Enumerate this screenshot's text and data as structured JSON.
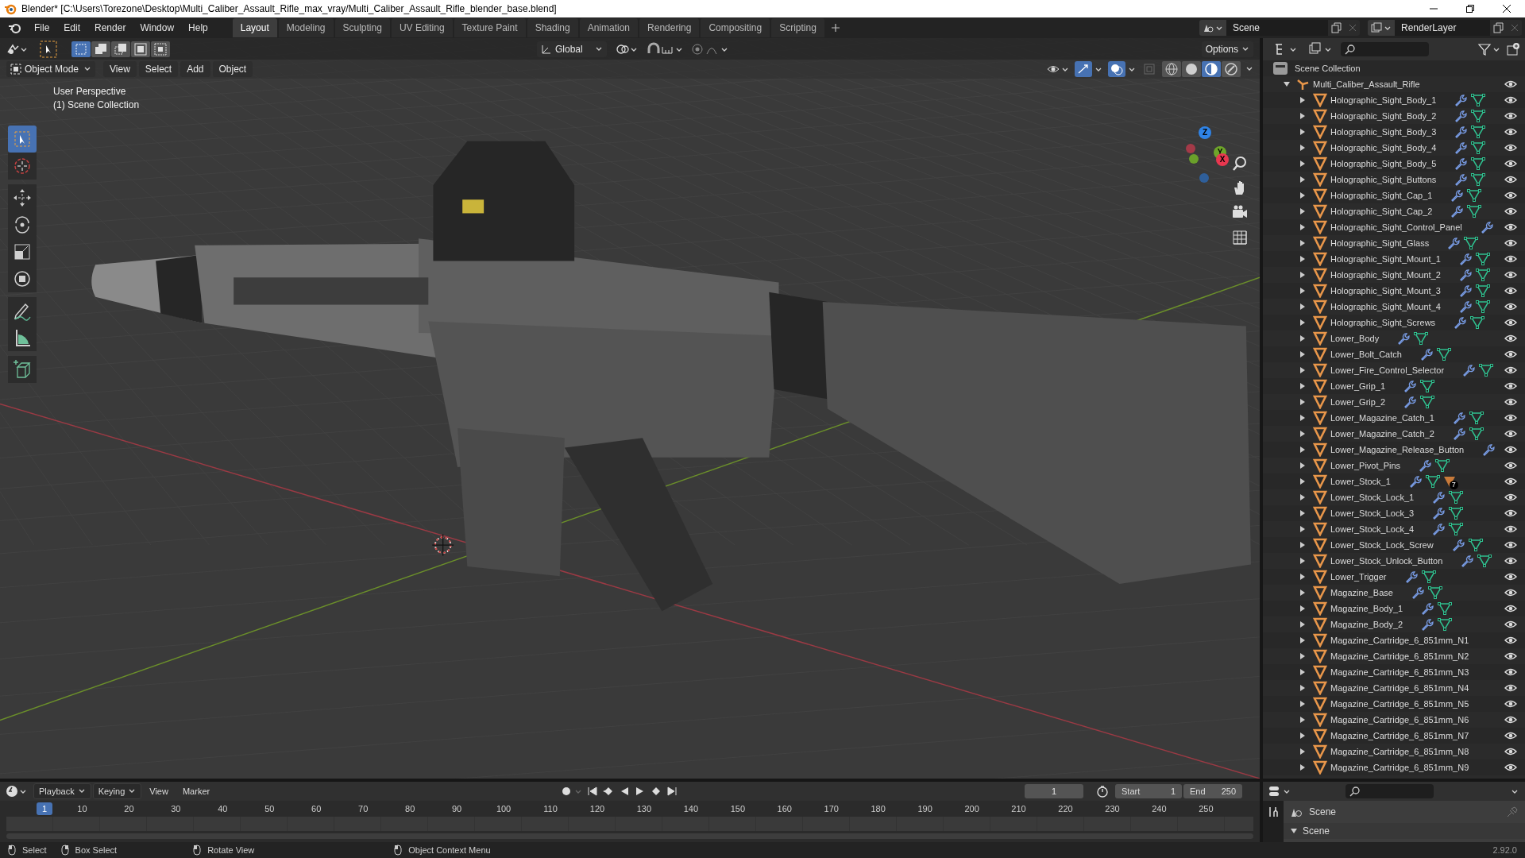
{
  "window": {
    "title": "Blender* [C:\\Users\\Torezone\\Desktop\\Multi_Caliber_Assault_Rifle_max_vray/Multi_Caliber_Assault_Rifle_blender_base.blend]"
  },
  "menu": [
    "File",
    "Edit",
    "Render",
    "Window",
    "Help"
  ],
  "workspaces": [
    {
      "label": "Layout",
      "selected": true
    },
    {
      "label": "Modeling",
      "selected": false
    },
    {
      "label": "Sculpting",
      "selected": false
    },
    {
      "label": "UV Editing",
      "selected": false
    },
    {
      "label": "Texture Paint",
      "selected": false
    },
    {
      "label": "Shading",
      "selected": false
    },
    {
      "label": "Animation",
      "selected": false
    },
    {
      "label": "Rendering",
      "selected": false
    },
    {
      "label": "Compositing",
      "selected": false
    },
    {
      "label": "Scripting",
      "selected": false
    }
  ],
  "scene": {
    "value": "Scene"
  },
  "view_layer": {
    "value": "RenderLayer"
  },
  "tool_header": {
    "select_modes": [
      {
        "selected": true
      },
      {
        "selected": false
      },
      {
        "selected": false
      },
      {
        "selected": false
      },
      {
        "selected": false
      }
    ],
    "orientation": "Global",
    "options": "Options"
  },
  "viewport": {
    "mode": "Object Mode",
    "menus": [
      "View",
      "Select",
      "Add",
      "Object"
    ],
    "view_name": "User Perspective",
    "collection_label": "(1) Scene Collection",
    "tools": [
      {
        "kind": "select_box",
        "selected": true
      },
      {
        "kind": "cursor",
        "selected": false
      },
      {
        "kind": "move",
        "selected": false
      },
      {
        "kind": "rotate",
        "selected": false
      },
      {
        "kind": "scale",
        "selected": false
      },
      {
        "kind": "transform",
        "selected": false
      },
      {
        "kind": "annotate",
        "selected": false
      },
      {
        "kind": "measure",
        "selected": false
      },
      {
        "kind": "add_cube",
        "selected": false
      }
    ],
    "shading": [
      {
        "kind": "wireframe",
        "selected": false
      },
      {
        "kind": "solid",
        "selected": false
      },
      {
        "kind": "material",
        "selected": true
      },
      {
        "kind": "rendered",
        "selected": false
      }
    ],
    "gizmo_axes": [
      {
        "label": "Z",
        "color": "#2f83e6"
      },
      {
        "label": "Y",
        "color": "#6ea52a"
      },
      {
        "label": "X",
        "color": "#e8374f"
      }
    ]
  },
  "outliner": {
    "root": "Scene Collection",
    "collections": [
      {
        "name": "Multi_Caliber_Assault_Rifle",
        "expanded": true,
        "children": [
          {
            "name": "Holographic_Sight_Body_1",
            "expanded": false,
            "modifier": true,
            "mesh": true,
            "visible": true
          },
          {
            "name": "Holographic_Sight_Body_2",
            "expanded": false,
            "modifier": true,
            "mesh": true,
            "visible": true
          },
          {
            "name": "Holographic_Sight_Body_3",
            "expanded": false,
            "modifier": true,
            "mesh": true,
            "visible": true
          },
          {
            "name": "Holographic_Sight_Body_4",
            "expanded": false,
            "modifier": true,
            "mesh": true,
            "visible": true
          },
          {
            "name": "Holographic_Sight_Body_5",
            "expanded": false,
            "modifier": true,
            "mesh": true,
            "visible": true
          },
          {
            "name": "Holographic_Sight_Buttons",
            "expanded": false,
            "modifier": true,
            "mesh": true,
            "visible": true
          },
          {
            "name": "Holographic_Sight_Cap_1",
            "expanded": false,
            "modifier": true,
            "mesh": true,
            "visible": true
          },
          {
            "name": "Holographic_Sight_Cap_2",
            "expanded": false,
            "modifier": true,
            "mesh": true,
            "visible": true
          },
          {
            "name": "Holographic_Sight_Control_Panel",
            "expanded": false,
            "modifier": true,
            "mesh": false,
            "visible": true
          },
          {
            "name": "Holographic_Sight_Glass",
            "expanded": false,
            "modifier": true,
            "mesh": true,
            "visible": true
          },
          {
            "name": "Holographic_Sight_Mount_1",
            "expanded": false,
            "modifier": true,
            "mesh": true,
            "visible": true
          },
          {
            "name": "Holographic_Sight_Mount_2",
            "expanded": false,
            "modifier": true,
            "mesh": true,
            "visible": true
          },
          {
            "name": "Holographic_Sight_Mount_3",
            "expanded": false,
            "modifier": true,
            "mesh": true,
            "visible": true
          },
          {
            "name": "Holographic_Sight_Mount_4",
            "expanded": false,
            "modifier": true,
            "mesh": true,
            "visible": true
          },
          {
            "name": "Holographic_Sight_Screws",
            "expanded": false,
            "modifier": true,
            "mesh": true,
            "visible": true
          },
          {
            "name": "Lower_Body",
            "expanded": false,
            "modifier": true,
            "mesh": true,
            "visible": true
          },
          {
            "name": "Lower_Bolt_Catch",
            "expanded": false,
            "modifier": true,
            "mesh": true,
            "visible": true
          },
          {
            "name": "Lower_Fire_Control_Selector",
            "expanded": false,
            "modifier": true,
            "mesh": true,
            "visible": true
          },
          {
            "name": "Lower_Grip_1",
            "expanded": false,
            "modifier": true,
            "mesh": true,
            "visible": true
          },
          {
            "name": "Lower_Grip_2",
            "expanded": false,
            "modifier": true,
            "mesh": true,
            "visible": true
          },
          {
            "name": "Lower_Magazine_Catch_1",
            "expanded": false,
            "modifier": true,
            "mesh": true,
            "visible": true
          },
          {
            "name": "Lower_Magazine_Catch_2",
            "expanded": false,
            "modifier": true,
            "mesh": true,
            "visible": true
          },
          {
            "name": "Lower_Magazine_Release_Button",
            "expanded": false,
            "modifier": true,
            "mesh": false,
            "visible": true
          },
          {
            "name": "Lower_Pivot_Pins",
            "expanded": false,
            "modifier": true,
            "mesh": true,
            "visible": true
          },
          {
            "name": "Lower_Stock_1",
            "expanded": false,
            "modifier": true,
            "mesh": true,
            "material_count": "7",
            "visible": true
          },
          {
            "name": "Lower_Stock_Lock_1",
            "expanded": false,
            "modifier": true,
            "mesh": true,
            "visible": true
          },
          {
            "name": "Lower_Stock_Lock_3",
            "expanded": false,
            "modifier": true,
            "mesh": true,
            "visible": true
          },
          {
            "name": "Lower_Stock_Lock_4",
            "expanded": false,
            "modifier": true,
            "mesh": true,
            "visible": true
          },
          {
            "name": "Lower_Stock_Lock_Screw",
            "expanded": false,
            "modifier": true,
            "mesh": true,
            "visible": true
          },
          {
            "name": "Lower_Stock_Unlock_Button",
            "expanded": false,
            "modifier": true,
            "mesh": true,
            "visible": true
          },
          {
            "name": "Lower_Trigger",
            "expanded": false,
            "modifier": true,
            "mesh": true,
            "visible": true
          },
          {
            "name": "Magazine_Base",
            "expanded": false,
            "modifier": true,
            "mesh": true,
            "visible": true
          },
          {
            "name": "Magazine_Body_1",
            "expanded": false,
            "modifier": true,
            "mesh": true,
            "visible": true
          },
          {
            "name": "Magazine_Body_2",
            "expanded": false,
            "modifier": true,
            "mesh": true,
            "visible": true
          },
          {
            "name": "Magazine_Cartridge_6_851mm_N1",
            "expanded": false,
            "modifier": false,
            "mesh": false,
            "visible": true
          },
          {
            "name": "Magazine_Cartridge_6_851mm_N2",
            "expanded": false,
            "modifier": false,
            "mesh": false,
            "visible": true
          },
          {
            "name": "Magazine_Cartridge_6_851mm_N3",
            "expanded": false,
            "modifier": false,
            "mesh": false,
            "visible": true
          },
          {
            "name": "Magazine_Cartridge_6_851mm_N4",
            "expanded": false,
            "modifier": false,
            "mesh": false,
            "visible": true
          },
          {
            "name": "Magazine_Cartridge_6_851mm_N5",
            "expanded": false,
            "modifier": false,
            "mesh": false,
            "visible": true
          },
          {
            "name": "Magazine_Cartridge_6_851mm_N6",
            "expanded": false,
            "modifier": false,
            "mesh": false,
            "visible": true
          },
          {
            "name": "Magazine_Cartridge_6_851mm_N7",
            "expanded": false,
            "modifier": false,
            "mesh": false,
            "visible": true
          },
          {
            "name": "Magazine_Cartridge_6_851mm_N8",
            "expanded": false,
            "modifier": false,
            "mesh": false,
            "visible": true
          },
          {
            "name": "Magazine_Cartridge_6_851mm_N9",
            "expanded": false,
            "modifier": false,
            "mesh": false,
            "visible": true
          }
        ]
      }
    ]
  },
  "timeline": {
    "menus": [
      "Playback",
      "Keying",
      "View",
      "Marker"
    ],
    "current_frame": "1",
    "start_label": "Start",
    "start": "1",
    "end_label": "End",
    "end": "250",
    "playhead": "1",
    "ticks": [
      "10",
      "20",
      "30",
      "40",
      "50",
      "60",
      "70",
      "80",
      "90",
      "100",
      "110",
      "120",
      "130",
      "140",
      "150",
      "160",
      "170",
      "180",
      "190",
      "200",
      "210",
      "220",
      "230",
      "240",
      "250"
    ]
  },
  "properties": {
    "context": "Scene",
    "section": "Scene",
    "section_expanded": true
  },
  "status_bar": {
    "hints": [
      {
        "label": "Select"
      },
      {
        "label": "Box Select"
      },
      {
        "label": "Rotate View"
      },
      {
        "label": "Object Context Menu"
      }
    ],
    "version": "2.92.0"
  }
}
